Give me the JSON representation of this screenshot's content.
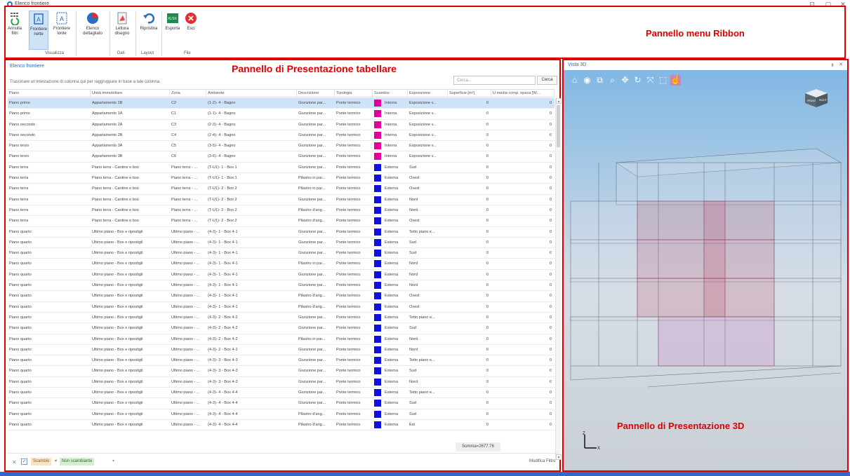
{
  "window": {
    "title": "Elenco frontiere",
    "controls": [
      "⊡",
      "▢",
      "✕"
    ]
  },
  "ribbon": {
    "callout": "Pannello menu Ribbon",
    "buttons": {
      "annulla_filtri": "Annulla filtri",
      "frontiere_nette": "Frontiere nette",
      "frontiere_lorde": "Frontiere lorde",
      "elenco_dettagliato": "Elenco dettagliato",
      "lettura_disegno": "Lettura disegno",
      "ripristina": "Ripristina",
      "esporta": "Esporta",
      "esci": "Esci"
    },
    "groups": {
      "visualizza": "Visualizza",
      "dati": "Dati",
      "layout": "Layout",
      "file": "File"
    }
  },
  "table_panel": {
    "title": "Elenco frontiere",
    "callout": "Pannello di Presentazione tabellare",
    "hint": "Trascinare un'intestazione di colonna qui per raggruppare in base a tale colonna.",
    "search_placeholder": "Cerca...",
    "search_button": "Cerca",
    "columns": [
      "Piano",
      "Unità immobiliare",
      "Zona",
      "Ambiente",
      "Descrizione",
      "Tipologia",
      "Scambio",
      "Esposizione",
      "Superficie [m²]",
      "U media comp. opaca [W..."
    ],
    "rows": [
      [
        "Piano primo",
        "Appartamento 1B",
        "C2",
        "(1-2)-  4 - Bagno",
        "Giunzione par...",
        "Ponte termico",
        "#e0009a",
        "Interna",
        "Esposizione v...",
        "0",
        "0"
      ],
      [
        "Piano primo",
        "Appartamento 1A",
        "C1",
        "(1-1)-  4 - Bagno",
        "Giunzione par...",
        "Ponte termico",
        "#e0009a",
        "Interna",
        "Esposizione v...",
        "0",
        "0"
      ],
      [
        "Piano secondo",
        "Appartamento 2A",
        "C3",
        "(2-3)-  4 - Bagno",
        "Giunzione par...",
        "Ponte termico",
        "#e0009a",
        "Interna",
        "Esposizione v...",
        "0",
        "0"
      ],
      [
        "Piano secondo",
        "Appartamento 2B",
        "C4",
        "(2-4)-  4 - Bagno",
        "Giunzione par...",
        "Ponte termico",
        "#e0009a",
        "Interna",
        "Esposizione v...",
        "0",
        "0"
      ],
      [
        "Piano terzo",
        "Appartamento 3A",
        "C5",
        "(3-5)-  4 - Bagno",
        "Giunzione par...",
        "Ponte termico",
        "#e0009a",
        "Interna",
        "Esposizione v...",
        "0",
        "0"
      ],
      [
        "Piano terzo",
        "Appartamento 3B",
        "C6",
        "(3-6)-  4 - Bagno",
        "Giunzione par...",
        "Ponte termico",
        "#e0009a",
        "Interna",
        "Esposizione v...",
        "0",
        "0"
      ],
      [
        "Piano terra",
        "Piano terra - Cantine e box",
        "Piano terra - ...",
        "(T-U1)-  1 - Box 1",
        "Giunzione par...",
        "Ponte termico",
        "#1010dd",
        "Esterna",
        "Sud",
        "0",
        "0"
      ],
      [
        "Piano terra",
        "Piano terra - Cantine e box",
        "Piano terra - ...",
        "(T-U1)-  1 - Box 1",
        "Pilastro in par...",
        "Ponte termico",
        "#1010dd",
        "Esterna",
        "Ovest",
        "0",
        "0"
      ],
      [
        "Piano terra",
        "Piano terra - Cantine e box",
        "Piano terra - ...",
        "(T-U1)-  2 - Box 2",
        "Pilastro in par...",
        "Ponte termico",
        "#1010dd",
        "Esterna",
        "Ovest",
        "0",
        "0"
      ],
      [
        "Piano terra",
        "Piano terra - Cantine e box",
        "Piano terra - ...",
        "(T-U1)-  2 - Box 2",
        "Giunzione par...",
        "Ponte termico",
        "#1010dd",
        "Esterna",
        "Nord",
        "0",
        "0"
      ],
      [
        "Piano terra",
        "Piano terra - Cantine e box",
        "Piano terra - ...",
        "(T-U1)-  2 - Box 2",
        "Pilastro d'ang...",
        "Ponte termico",
        "#1010dd",
        "Esterna",
        "Nord",
        "0",
        "0"
      ],
      [
        "Piano terra",
        "Piano terra - Cantine e box",
        "Piano terra - ...",
        "(T-U1)-  2 - Box 2",
        "Pilastro d'ang...",
        "Ponte termico",
        "#1010dd",
        "Esterna",
        "Ovest",
        "0",
        "0"
      ],
      [
        "Piano quarto",
        "Ultimo piano - Box e ripostigli",
        "Ultimo piano - ...",
        "(4-3)-  1 - Box 4-1",
        "Giunzione par...",
        "Ponte termico",
        "#1010dd",
        "Esterna",
        "Tetto piano e...",
        "0",
        "0"
      ],
      [
        "Piano quarto",
        "Ultimo piano - Box e ripostigli",
        "Ultimo piano - ...",
        "(4-3)-  1 - Box 4-1",
        "Giunzione par...",
        "Ponte termico",
        "#1010dd",
        "Esterna",
        "Sud",
        "0",
        "0"
      ],
      [
        "Piano quarto",
        "Ultimo piano - Box e ripostigli",
        "Ultimo piano - ...",
        "(4-3)-  1 - Box 4-1",
        "Giunzione par...",
        "Ponte termico",
        "#1010dd",
        "Esterna",
        "Sud",
        "0",
        "0"
      ],
      [
        "Piano quarto",
        "Ultimo piano - Box e ripostigli",
        "Ultimo piano - ...",
        "(4-3)-  1 - Box 4-1",
        "Pilastro in par...",
        "Ponte termico",
        "#1010dd",
        "Esterna",
        "Nord",
        "0",
        "0"
      ],
      [
        "Piano quarto",
        "Ultimo piano - Box e ripostigli",
        "Ultimo piano - ...",
        "(4-3)-  1 - Box 4-1",
        "Giunzione par...",
        "Ponte termico",
        "#1010dd",
        "Esterna",
        "Nord",
        "0",
        "0"
      ],
      [
        "Piano quarto",
        "Ultimo piano - Box e ripostigli",
        "Ultimo piano - ...",
        "(4-3)-  1 - Box 4-1",
        "Giunzione par...",
        "Ponte termico",
        "#1010dd",
        "Esterna",
        "Nord",
        "0",
        "0"
      ],
      [
        "Piano quarto",
        "Ultimo piano - Box e ripostigli",
        "Ultimo piano - ...",
        "(4-3)-  1 - Box 4-1",
        "Pilastro d'ang...",
        "Ponte termico",
        "#1010dd",
        "Esterna",
        "Ovest",
        "0",
        "0"
      ],
      [
        "Piano quarto",
        "Ultimo piano - Box e ripostigli",
        "Ultimo piano - ...",
        "(4-3)-  1 - Box 4-1",
        "Pilastro d'ang...",
        "Ponte termico",
        "#1010dd",
        "Esterna",
        "Ovest",
        "0",
        "0"
      ],
      [
        "Piano quarto",
        "Ultimo piano - Box e ripostigli",
        "Ultimo piano - ...",
        "(4-3)-  2 - Box 4-2",
        "Giunzione par...",
        "Ponte termico",
        "#1010dd",
        "Esterna",
        "Tetto piano e...",
        "0",
        "0"
      ],
      [
        "Piano quarto",
        "Ultimo piano - Box e ripostigli",
        "Ultimo piano - ...",
        "(4-3)-  2 - Box 4-2",
        "Giunzione par...",
        "Ponte termico",
        "#1010dd",
        "Esterna",
        "Sud",
        "0",
        "0"
      ],
      [
        "Piano quarto",
        "Ultimo piano - Box e ripostigli",
        "Ultimo piano - ...",
        "(4-3)-  2 - Box 4-2",
        "Pilastro in par...",
        "Ponte termico",
        "#1010dd",
        "Esterna",
        "Nord",
        "0",
        "0"
      ],
      [
        "Piano quarto",
        "Ultimo piano - Box e ripostigli",
        "Ultimo piano - ...",
        "(4-3)-  2 - Box 4-2",
        "Giunzione par...",
        "Ponte termico",
        "#1010dd",
        "Esterna",
        "Nord",
        "0",
        "0"
      ],
      [
        "Piano quarto",
        "Ultimo piano - Box e ripostigli",
        "Ultimo piano - ...",
        "(4-3)-  3 - Box 4-3",
        "Giunzione par...",
        "Ponte termico",
        "#1010dd",
        "Esterna",
        "Tetto piano e...",
        "0",
        "0"
      ],
      [
        "Piano quarto",
        "Ultimo piano - Box e ripostigli",
        "Ultimo piano - ...",
        "(4-3)-  3 - Box 4-3",
        "Giunzione par...",
        "Ponte termico",
        "#1010dd",
        "Esterna",
        "Sud",
        "0",
        "0"
      ],
      [
        "Piano quarto",
        "Ultimo piano - Box e ripostigli",
        "Ultimo piano - ...",
        "(4-3)-  3 - Box 4-3",
        "Giunzione par...",
        "Ponte termico",
        "#1010dd",
        "Esterna",
        "Nord",
        "0",
        "0"
      ],
      [
        "Piano quarto",
        "Ultimo piano - Box e ripostigli",
        "Ultimo piano - ...",
        "(4-3)-  4 - Box 4-4",
        "Giunzione par...",
        "Ponte termico",
        "#1010dd",
        "Esterna",
        "Tetto piano e...",
        "0",
        "0"
      ],
      [
        "Piano quarto",
        "Ultimo piano - Box e ripostigli",
        "Ultimo piano - ...",
        "(4-3)-  4 - Box 4-4",
        "Giunzione par...",
        "Ponte termico",
        "#1010dd",
        "Esterna",
        "Sud",
        "0",
        "0"
      ],
      [
        "Piano quarto",
        "Ultimo piano - Box e ripostigli",
        "Ultimo piano - ...",
        "(4-3)-  4 - Box 4-4",
        "Pilastro d'ang...",
        "Ponte termico",
        "#1010dd",
        "Esterna",
        "Sud",
        "0",
        "0"
      ],
      [
        "Piano quarto",
        "Ultimo piano - Box e ripostigli",
        "Ultimo piano - ...",
        "(4-3)-  4 - Box 4-4",
        "Pilastro d'ang...",
        "Ponte termico",
        "#1010dd",
        "Esterna",
        "Est",
        "0",
        "0"
      ]
    ],
    "sum": "Somma=2677.76",
    "filter": {
      "field": "Scambio",
      "operator": "≠",
      "value": "Non scambiante",
      "edit": "Modifica Filtro"
    }
  },
  "view3d": {
    "title": "Vista 3D",
    "callout": "Pannello di Presentazione 3D",
    "cube_labels": [
      "FRONT",
      "RIGHT"
    ],
    "axis_labels": [
      "Z",
      "X"
    ],
    "tools": [
      "home-icon",
      "orbit-icon",
      "zoom-window-icon",
      "zoom-icon",
      "pan-icon",
      "rotate-icon",
      "fit-icon",
      "box-view-icon",
      "select-icon"
    ]
  }
}
